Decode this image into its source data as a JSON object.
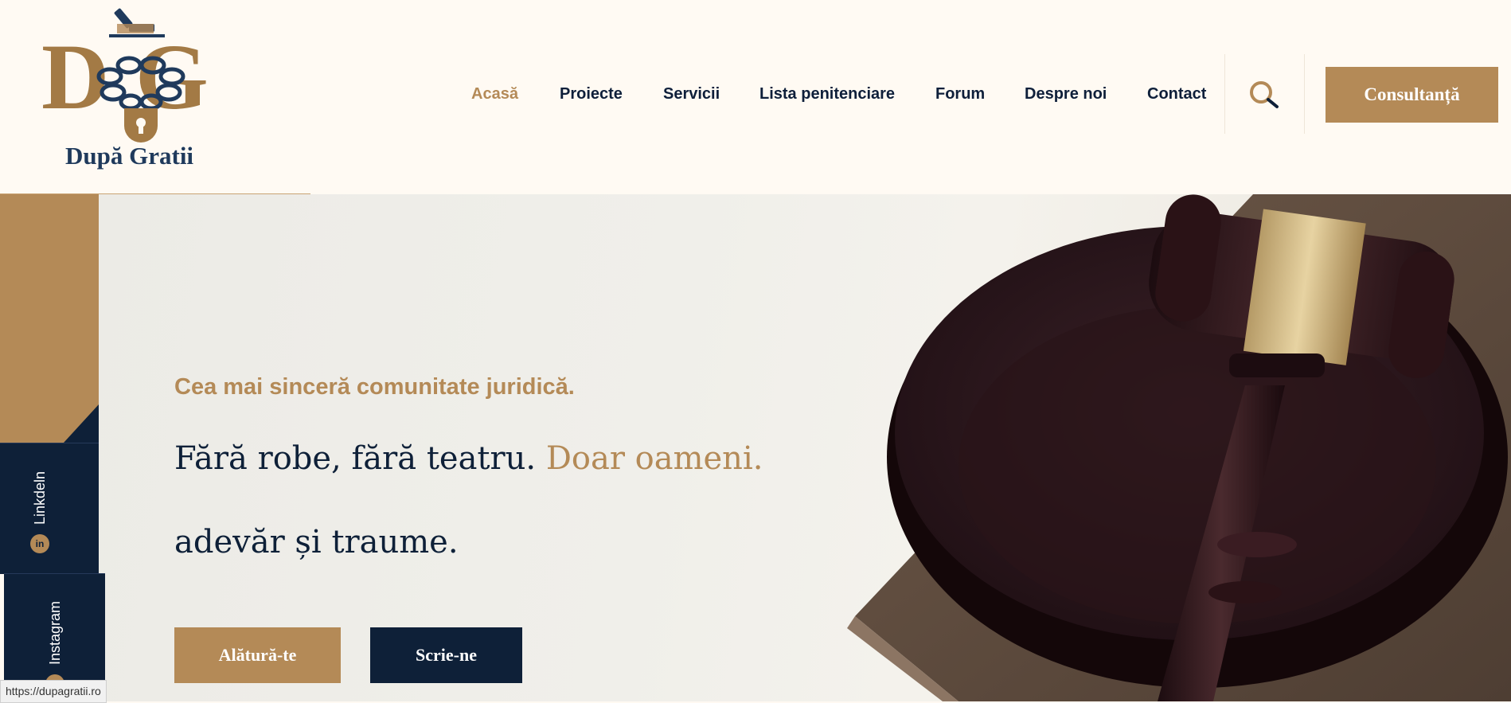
{
  "brand": {
    "name": "După Gratii",
    "colors": {
      "gold": "#b48a57",
      "navy": "#0e2038",
      "cream": "#fffaf3"
    }
  },
  "nav": {
    "items": [
      {
        "label": "Acasă",
        "active": true
      },
      {
        "label": "Proiecte"
      },
      {
        "label": "Servicii"
      },
      {
        "label": "Lista penitenciare"
      },
      {
        "label": "Forum"
      },
      {
        "label": "Despre noi"
      },
      {
        "label": "Contact"
      }
    ],
    "search_icon": "search-icon",
    "cta_label": "Consultanță"
  },
  "social": {
    "linkedin": {
      "label": "Linkdeln",
      "icon": "linkedin-icon"
    },
    "instagram": {
      "label": "Instagram",
      "icon": "instagram-icon"
    }
  },
  "hero": {
    "tagline": "Cea mai sinceră comunitate juridică.",
    "headline_main": "Fără robe, fără teatru.",
    "headline_accent": "Doar oameni.",
    "headline_line2": "adevăr și traume.",
    "btn_join": "Alătură-te",
    "btn_write": "Scrie-ne"
  },
  "status_bar": {
    "url": "https://dupagratii.ro"
  }
}
